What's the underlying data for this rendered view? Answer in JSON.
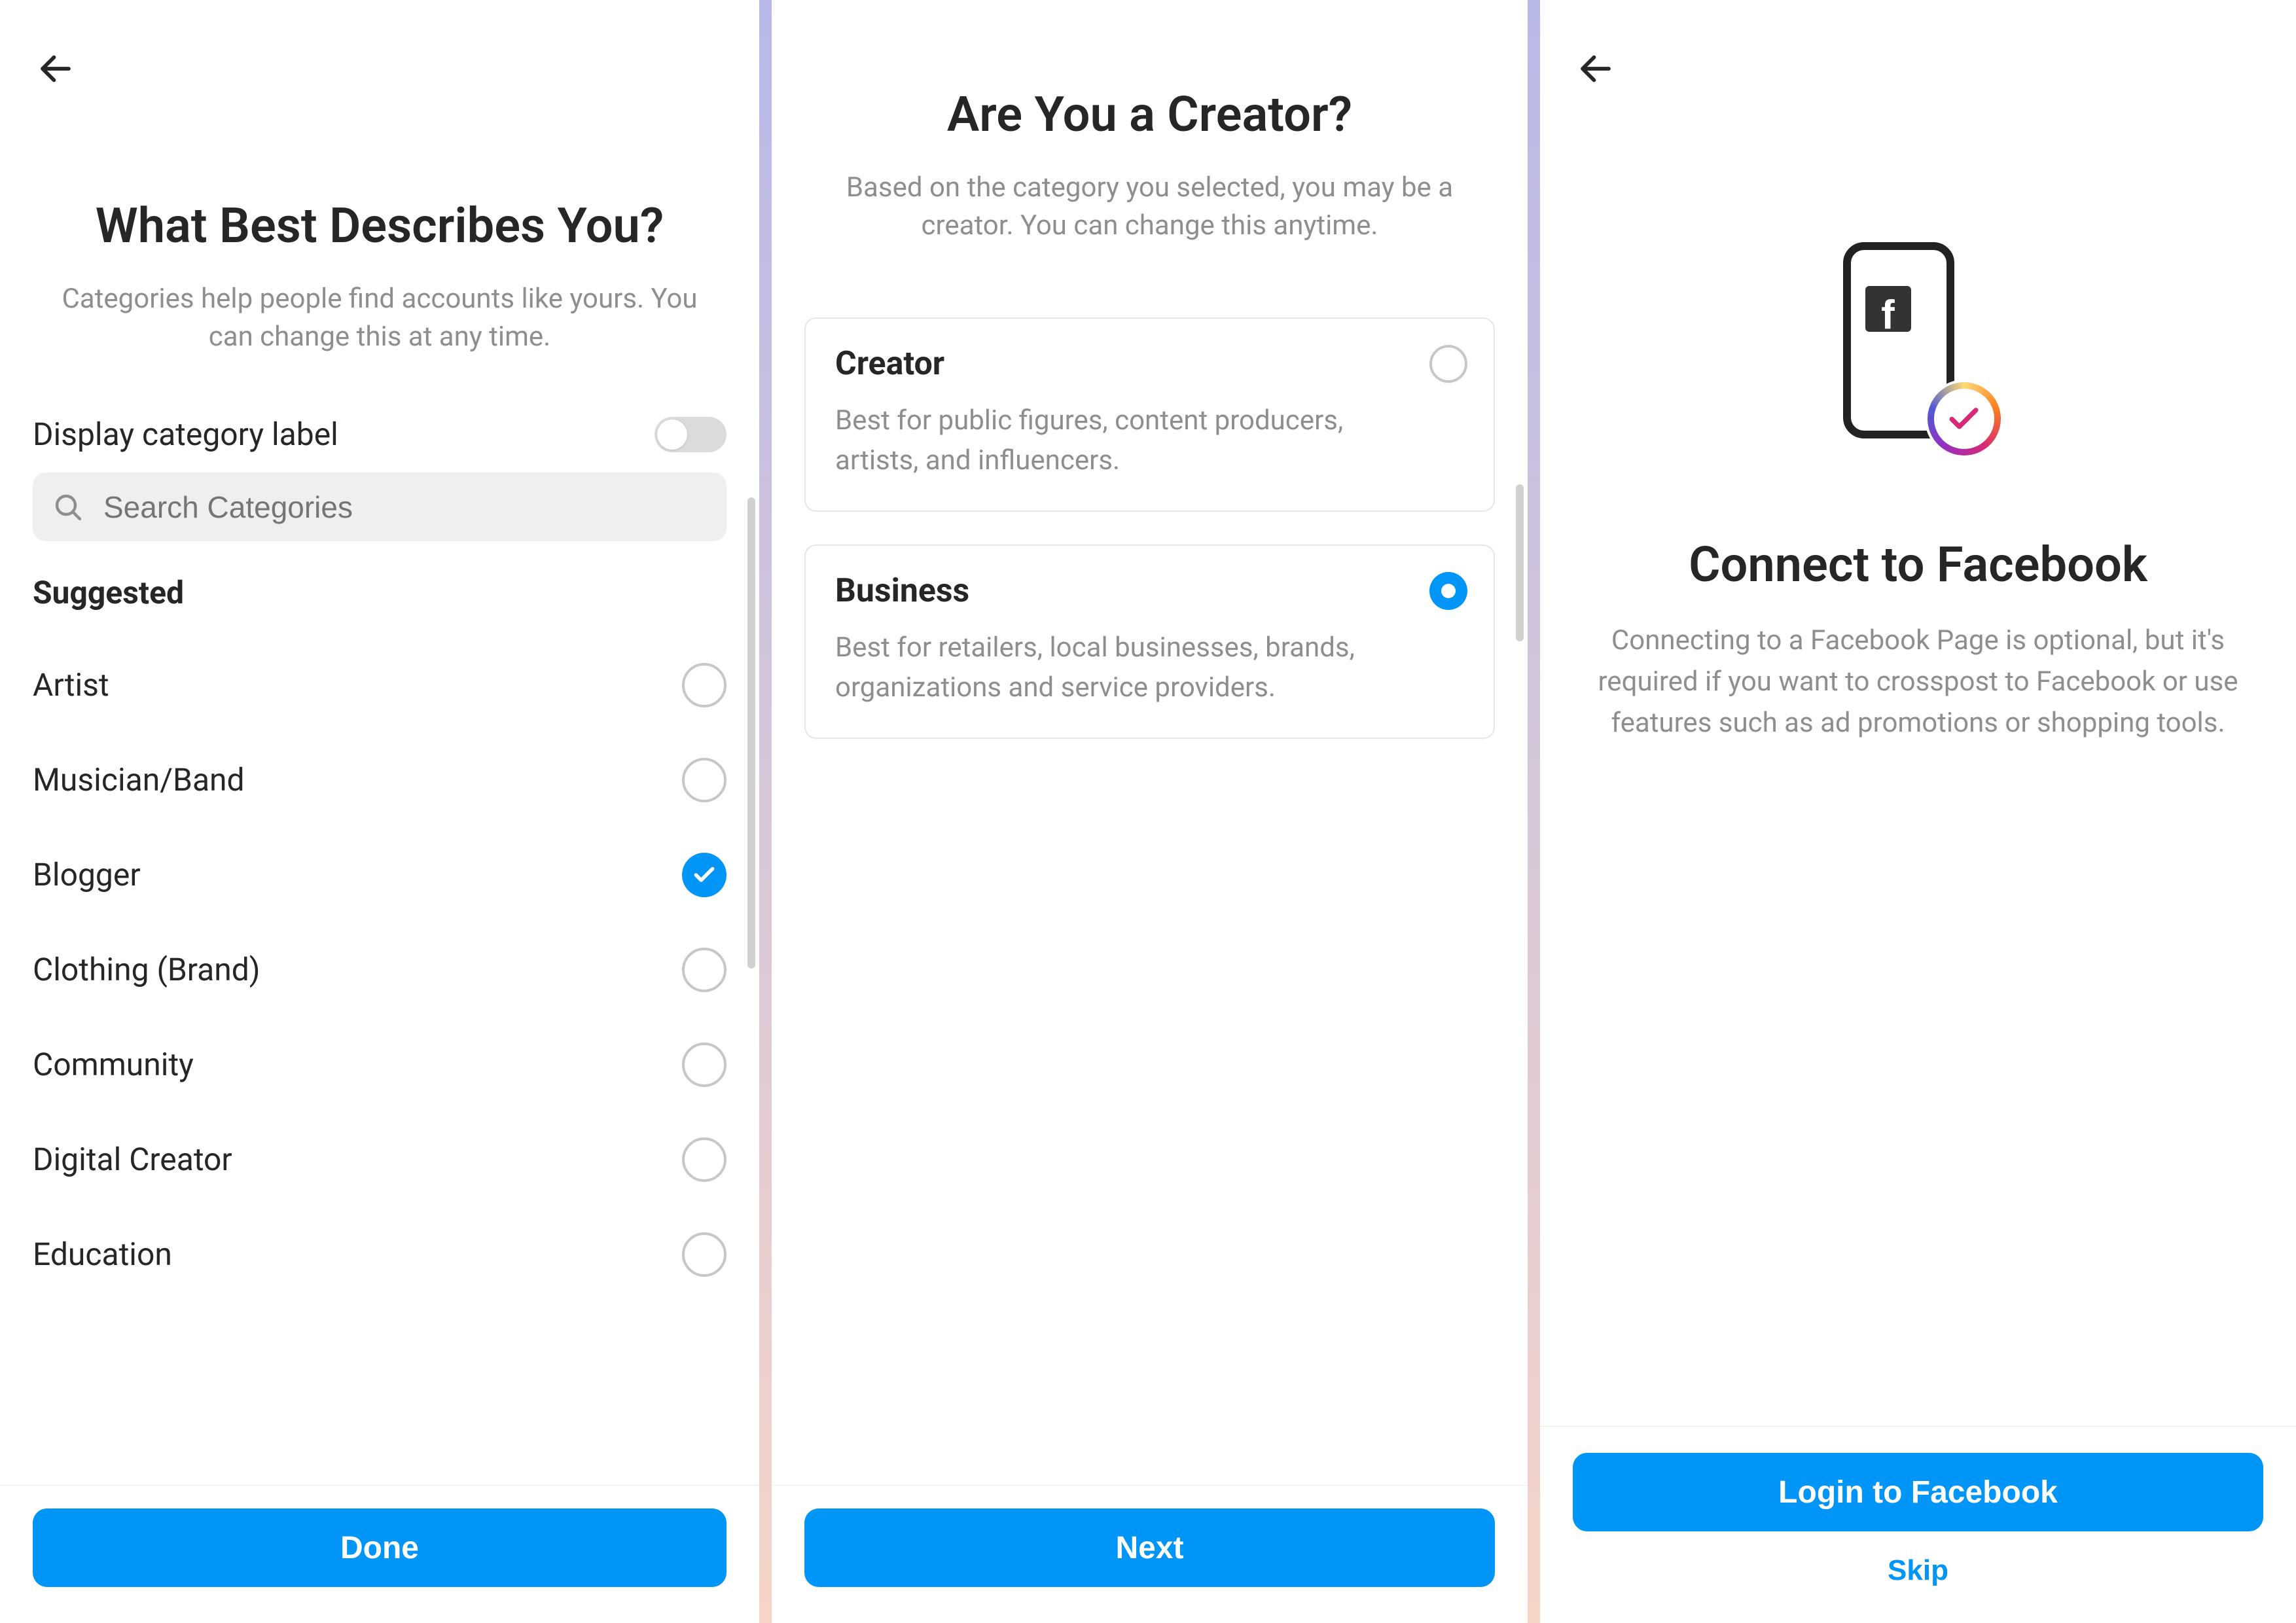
{
  "screen1": {
    "title": "What Best Describes You?",
    "subtitle": "Categories help people find accounts like yours. You can change this at any time.",
    "toggle_label": "Display category label",
    "toggle_on": false,
    "search_placeholder": "Search Categories",
    "section_header": "Suggested",
    "categories": [
      {
        "label": "Artist",
        "selected": false
      },
      {
        "label": "Musician/Band",
        "selected": false
      },
      {
        "label": "Blogger",
        "selected": true
      },
      {
        "label": "Clothing (Brand)",
        "selected": false
      },
      {
        "label": "Community",
        "selected": false
      },
      {
        "label": "Digital Creator",
        "selected": false
      },
      {
        "label": "Education",
        "selected": false
      }
    ],
    "button": "Done"
  },
  "screen2": {
    "title": "Are You a Creator?",
    "subtitle": "Based on the category you selected, you may be a creator. You can change this anytime.",
    "options": [
      {
        "title": "Creator",
        "desc": "Best for public figures, content producers, artists, and influencers.",
        "selected": false
      },
      {
        "title": "Business",
        "desc": "Best for retailers, local businesses, brands, organizations and service providers.",
        "selected": true
      }
    ],
    "button": "Next"
  },
  "screen3": {
    "title": "Connect to Facebook",
    "subtitle": "Connecting to a Facebook Page is optional, but it's required if you want to crosspost to Facebook or use features such as ad promotions or shopping tools.",
    "button_primary": "Login to Facebook",
    "button_skip": "Skip"
  },
  "colors": {
    "accent": "#0095f6",
    "text_secondary": "#8e8e8e"
  }
}
